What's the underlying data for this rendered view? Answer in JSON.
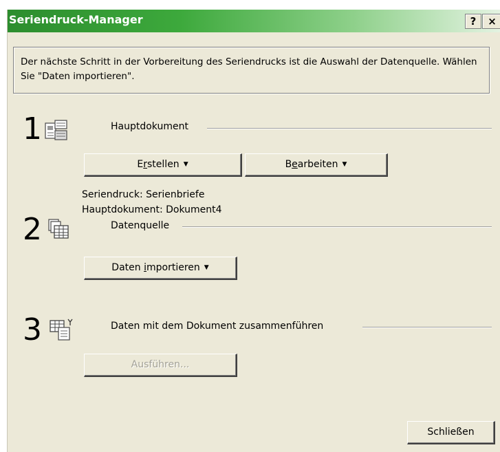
{
  "window": {
    "title": "Seriendruck-Manager",
    "help_label": "?",
    "close_label": "×"
  },
  "info_text": "Der nächste Schritt in der Vorbereitung des Seriendrucks ist die Auswahl der Datenquelle. Wählen Sie \"Daten importieren\".",
  "steps": [
    {
      "number": "1",
      "icon": "main-document-icon",
      "label": "Hauptdokument",
      "buttons": [
        {
          "pre": "E",
          "ul": "r",
          "post": "stellen",
          "caret": "▼"
        },
        {
          "pre": "B",
          "ul": "e",
          "post": "arbeiten",
          "caret": "▼"
        }
      ],
      "status": [
        "Seriendruck: Serienbriefe",
        "Hauptdokument: Dokument4"
      ]
    },
    {
      "number": "2",
      "icon": "data-source-icon",
      "label": "Datenquelle",
      "buttons": [
        {
          "pre": "Daten ",
          "ul": "i",
          "post": "mportieren",
          "caret": "▼"
        }
      ]
    },
    {
      "number": "3",
      "icon": "merge-data-icon",
      "label": "Daten mit dem Dokument zusammenführen",
      "buttons": [
        {
          "label": "Ausführen...",
          "disabled": true
        }
      ]
    }
  ],
  "close_button": "Schließen",
  "colors": {
    "dialog_bg": "#ece9d8",
    "title_green": "#2c8d2e",
    "disabled_text": "#a3a196"
  }
}
